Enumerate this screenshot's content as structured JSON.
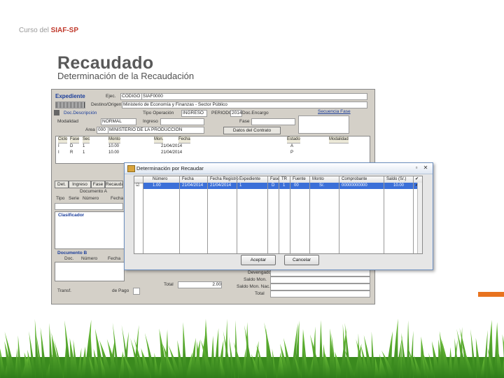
{
  "header": {
    "course_prefix": "Curso del ",
    "course_brand": "SIAF-SP",
    "title": "Recaudado",
    "subtitle": "Determinación de la Recaudación"
  },
  "screenshot": {
    "expediente_label": "Expediente",
    "ejec_label": "Ejec.",
    "ejec_code": "CODIGO",
    "ejec_name": "SIAF0000",
    "destino_label": "Destino/Origen",
    "destino_value": "Ministerio de Economía y Finanzas - Sector Público",
    "doc_label": "Doc.Descripción",
    "tipo_op_label": "Tipo Operación",
    "tipo_op_value": "INGRESO",
    "periodo_label": "PERIODO",
    "periodo_value": "2014",
    "doc_encargo": "Doc.Encargo",
    "secuencia_label": "Secuencia Fase",
    "modalidad_label": "Modalidad",
    "modalidad_value": "NORMAL",
    "fase_label": "Fase",
    "ingreso_label": "Ingreso",
    "area_label": "Area",
    "area_code": "000",
    "area_name": "MINISTERIO DE LA PRODUCCIÓN",
    "datos_contrato": "Datos del Contrato",
    "grid_headers": [
      "Ciclo",
      "Fase",
      "Sec",
      "Monto",
      "Mon.",
      "Fecha",
      "Estado",
      "Modalidad"
    ],
    "rows": [
      {
        "ciclo": "I",
        "fase": "D",
        "sec": "1",
        "monto": "10.00",
        "fecha": "21/04/2014",
        "estado": "A"
      },
      {
        "ciclo": "I",
        "fase": "R",
        "sec": "1",
        "monto": "10.00",
        "fecha": "21/04/2014",
        "estado": "P"
      }
    ],
    "tabs": [
      "Det.",
      "Ingreso",
      "Fase",
      "Recaudado"
    ],
    "documento_a": "Documento A",
    "tipo_label": "Tipo",
    "serie_label": "Serie",
    "numero_label": "Número",
    "fecha_label": "Fecha",
    "clasificador_label": "Clasificador",
    "documento_b": "Documento B",
    "doc_label_b": "Doc.",
    "numero_label_b": "Número",
    "fecha_label_b": "Fecha",
    "total_label": "Total",
    "total_value": "2.00",
    "transf_label": "Transf.",
    "pago_label": "de Pago",
    "bottom_right": [
      "Devengado",
      "Saldo Mon.",
      "Saldo Mon. Nac.",
      "Total"
    ]
  },
  "dialog": {
    "title": "Determinación por Recaudar",
    "columns": [
      "",
      "Número",
      "Fecha",
      "Fecha Registro",
      "Expediente",
      "Fase",
      "TR",
      "Fuente",
      "Monto",
      "Comprobante",
      "Saldo (S/.)",
      "✔"
    ],
    "row": [
      "☑",
      "1.00",
      "21/04/2014",
      "21/04/2014",
      "1",
      "D",
      "1",
      "00",
      "S/.",
      "00000000000",
      "10.00",
      "✔"
    ],
    "accept": "Aceptar",
    "cancel": "Cancelar"
  },
  "colors": {
    "accent": "#e8731f",
    "brand": "#c0392b",
    "selection": "#3b6fd8"
  }
}
